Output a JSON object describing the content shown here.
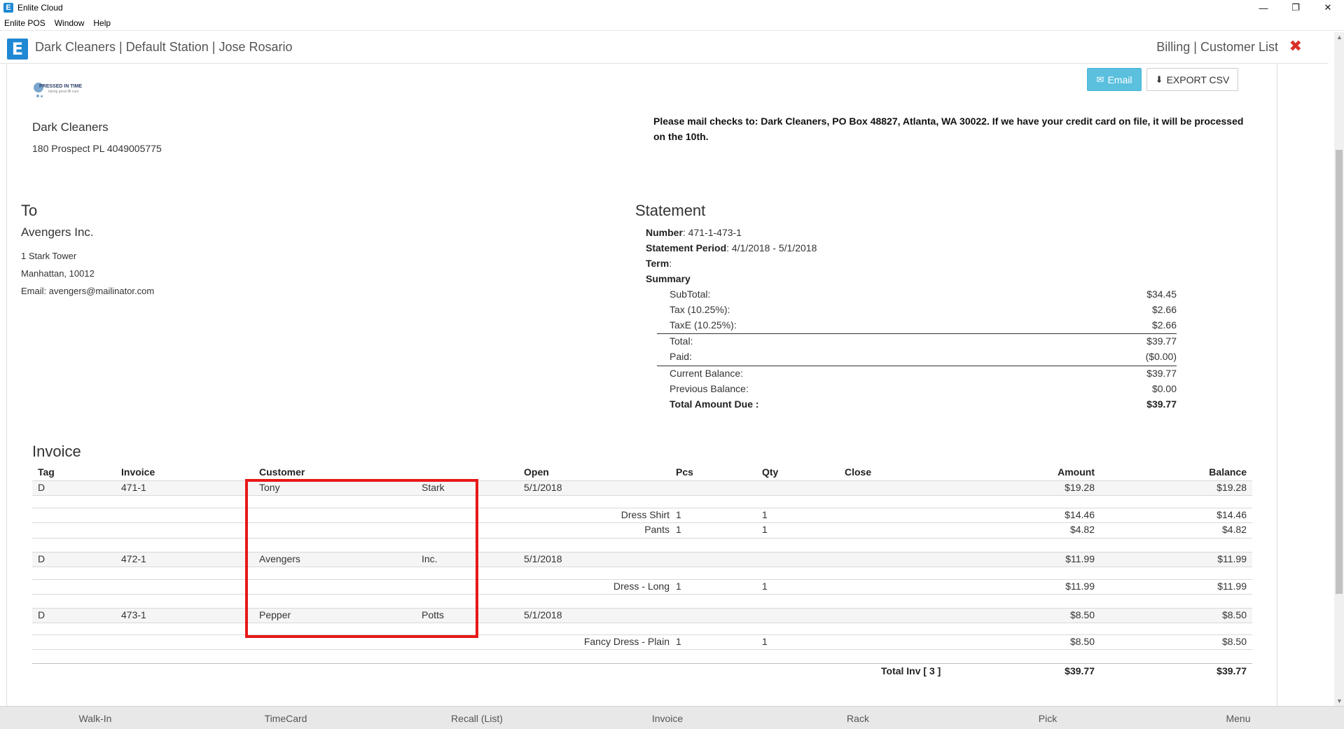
{
  "window": {
    "title": "Enlite Cloud",
    "app_icon_letter": "E",
    "minimize": "—",
    "restore": "❐",
    "close": "✕"
  },
  "menu": [
    "Enlite POS",
    "Window",
    "Help"
  ],
  "header": {
    "logo_letter": "E",
    "left": "Dark Cleaners | Default Station | Jose Rosario",
    "right": "Billing | Customer List",
    "close_icon": "✖"
  },
  "actions": {
    "email_label": "Email",
    "export_label": "EXPORT CSV"
  },
  "company": {
    "logo_text": "PRESSED IN TIME",
    "logo_tagline": "taking great fill care",
    "name": "Dark Cleaners",
    "address": "180 Prospect PL 4049005775"
  },
  "mail_note": "Please mail checks to: Dark Cleaners, PO Box 48827, Atlanta, WA 30022. If we have your credit card on file, it will be processed on the 10th.",
  "to": {
    "heading": "To",
    "name": "Avengers Inc.",
    "line1": "1 Stark Tower",
    "line2": "Manhattan, 10012",
    "email": "Email: avengers@mailinator.com"
  },
  "statement": {
    "heading": "Statement",
    "number_label": "Number",
    "number": ": 471-1-473-1",
    "period_label": "Statement Period",
    "period": ": 4/1/2018 - 5/1/2018",
    "term_label": "Term",
    "term": ":",
    "summary_label": "Summary",
    "summary": [
      {
        "label": "SubTotal:",
        "value": "$34.45"
      },
      {
        "label": "Tax (10.25%):",
        "value": "$2.66"
      },
      {
        "label": "TaxE (10.25%):",
        "value": "$2.66"
      },
      {
        "label": "Total:",
        "value": "$39.77"
      },
      {
        "label": "Paid:",
        "value": "($0.00)"
      },
      {
        "label": "Current Balance:",
        "value": "$39.77"
      },
      {
        "label": "Previous Balance:",
        "value": "$0.00"
      },
      {
        "label": "Total Amount Due :",
        "value": "$39.77"
      }
    ]
  },
  "invoice": {
    "heading": "Invoice",
    "columns": [
      "Tag",
      "Invoice",
      "Customer",
      "Open",
      "Pcs",
      "Qty",
      "Close",
      "Amount",
      "Balance"
    ],
    "rows": [
      {
        "tag": "D",
        "invoice": "471-1",
        "first": "Tony",
        "last": "Stark",
        "open": "5/1/2018",
        "amount": "$19.28",
        "balance": "$19.28"
      },
      {
        "item": "Dress Shirt",
        "pcs": "1",
        "qty": "1",
        "amount": "$14.46",
        "balance": "$14.46"
      },
      {
        "item": "Pants",
        "pcs": "1",
        "qty": "1",
        "amount": "$4.82",
        "balance": "$4.82"
      },
      {
        "tag": "D",
        "invoice": "472-1",
        "first": "Avengers",
        "last": "Inc.",
        "open": "5/1/2018",
        "amount": "$11.99",
        "balance": "$11.99"
      },
      {
        "item": "Dress - Long",
        "pcs": "1",
        "qty": "1",
        "amount": "$11.99",
        "balance": "$11.99"
      },
      {
        "tag": "D",
        "invoice": "473-1",
        "first": "Pepper",
        "last": "Potts",
        "open": "5/1/2018",
        "amount": "$8.50",
        "balance": "$8.50"
      },
      {
        "item": "Fancy Dress - Plain",
        "pcs": "1",
        "qty": "1",
        "amount": "$8.50",
        "balance": "$8.50"
      }
    ],
    "total_label": "Total Inv [ 3 ]",
    "total_amount": "$39.77",
    "total_balance": "$39.77"
  },
  "bottom_nav": [
    "Walk-In",
    "TimeCard",
    "Recall (List)",
    "Invoice",
    "Rack",
    "Pick",
    "Menu"
  ],
  "colors": {
    "brand": "#1e88d3",
    "email_button": "#5bc0de",
    "highlight": "#e81818",
    "close": "#d9302a"
  }
}
